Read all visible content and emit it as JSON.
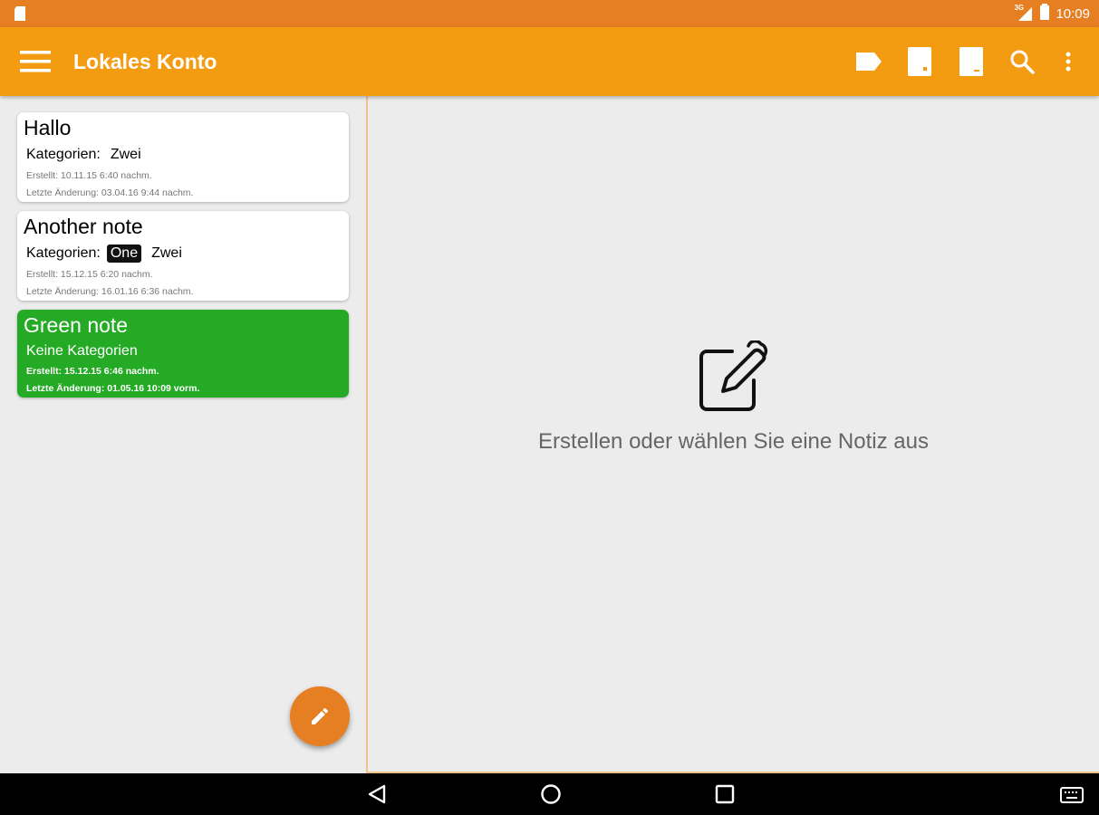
{
  "status_bar": {
    "time": "10:09",
    "network": "3G",
    "icons": [
      "sd-card-icon",
      "signal-icon",
      "battery-icon"
    ]
  },
  "app_bar": {
    "title": "Lokales Konto",
    "actions": [
      "label-icon",
      "notebook-icon",
      "notebook-icon",
      "search-icon",
      "more-vert-icon"
    ]
  },
  "notes": [
    {
      "title": "Hallo",
      "categories_label": "Kategorien:",
      "categories": [
        "Zwei"
      ],
      "created": "Erstellt: 10.11.15 6:40 nachm.",
      "modified": "Letzte Änderung: 03.04.16 9:44 nachm.",
      "color": "#ffffff"
    },
    {
      "title": "Another note",
      "categories_label": "Kategorien:",
      "categories": [
        "One",
        "Zwei"
      ],
      "created": "Erstellt: 15.12.15 6:20 nachm.",
      "modified": "Letzte Änderung: 16.01.16 6:36 nachm.",
      "color": "#ffffff"
    },
    {
      "title": "Green note",
      "categories_label": "Keine Kategorien",
      "categories": [],
      "created": "Erstellt: 15.12.15 6:46 nachm.",
      "modified": "Letzte Änderung: 01.05.16 10:09 vorm.",
      "color": "#25aa25"
    }
  ],
  "detail": {
    "empty_text": "Erstellen oder wählen Sie eine Notiz aus",
    "empty_icon": "edit-note-icon"
  },
  "fab": {
    "icon": "pencil-icon"
  },
  "nav_bar": {
    "icons": [
      "back-icon",
      "home-icon",
      "recents-icon",
      "keyboard-icon"
    ]
  },
  "colors": {
    "status_bar": "#e67e22",
    "app_bar": "#f39c12",
    "fab": "#e67e22",
    "green_note": "#25aa25"
  }
}
